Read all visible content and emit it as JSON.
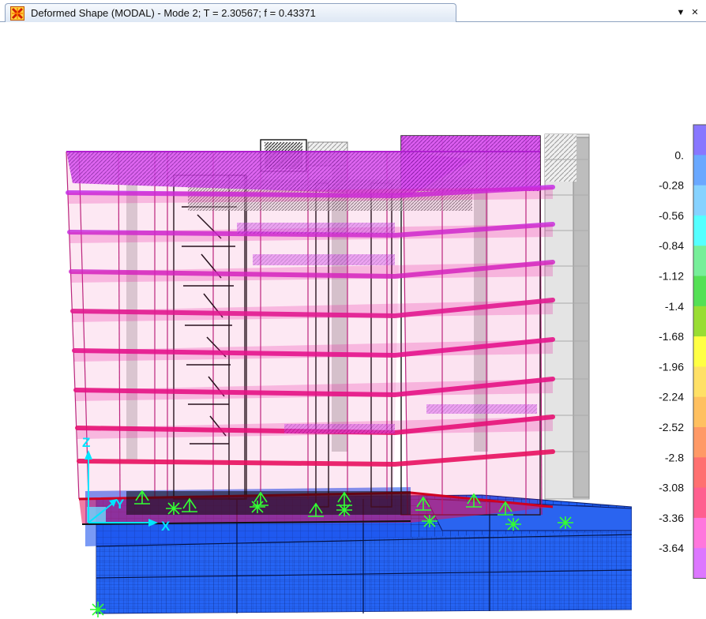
{
  "window": {
    "tab_title": "Deformed Shape (MODAL) - Mode 2; T = 2.30567;  f = 0.43371",
    "dropdown_icon": "chevron-down-icon",
    "close_icon": "close-icon",
    "app_icon": "sap2000-icon"
  },
  "axes": {
    "z_label": "Z",
    "y_label": "Y",
    "x_label": "X",
    "axis_color": "#00e5ff"
  },
  "legend": {
    "values": [
      "0.",
      "-0.28",
      "-0.56",
      "-0.84",
      "-1.12",
      "-1.4",
      "-1.68",
      "-1.96",
      "-2.24",
      "-2.52",
      "-2.8",
      "-3.08",
      "-3.36",
      "-3.64"
    ],
    "colors": [
      "#8877ff",
      "#6aa8ff",
      "#86d2ff",
      "#55ffff",
      "#77ee99",
      "#55e055",
      "#99dd33",
      "#ffff44",
      "#ffe066",
      "#ffc060",
      "#ff9966",
      "#ff7070",
      "#ff5f8f",
      "#ff77dd",
      "#dd77ff"
    ]
  },
  "model": {
    "upper_color": "#c030e8",
    "middle_color": "#e0108a",
    "lower_color": "#e8105a",
    "base_color": "#1e5bf0",
    "support_color": "#33ff33",
    "undeformed_color": "#a0a0a0"
  }
}
